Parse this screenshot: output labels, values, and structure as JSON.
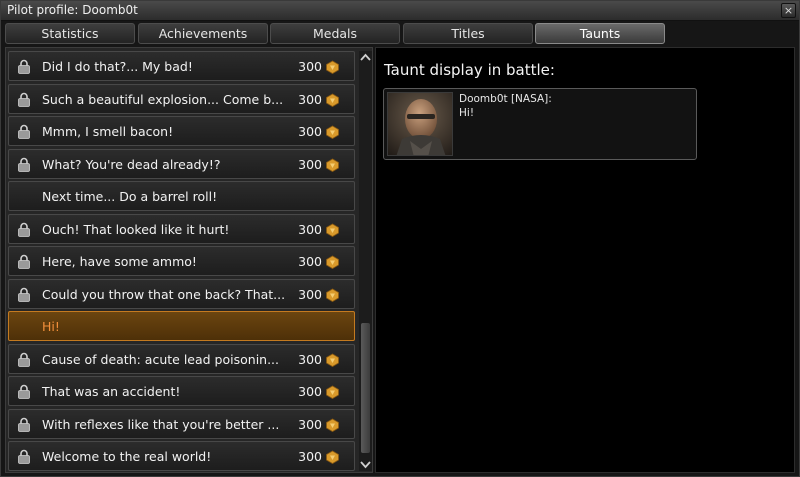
{
  "window": {
    "title": "Pilot profile: Doomb0t",
    "close_label": "×"
  },
  "tabs": [
    {
      "label": "Statistics",
      "active": false
    },
    {
      "label": "Achievements",
      "active": false
    },
    {
      "label": "Medals",
      "active": false
    },
    {
      "label": "Titles",
      "active": false
    },
    {
      "label": "Taunts",
      "active": true
    }
  ],
  "taunts": [
    {
      "text": "Did I do that?... My bad!",
      "price": "300",
      "locked": true,
      "selected": false
    },
    {
      "text": "Such a beautiful explosion... Come b...",
      "price": "300",
      "locked": true,
      "selected": false
    },
    {
      "text": "Mmm, I smell bacon!",
      "price": "300",
      "locked": true,
      "selected": false
    },
    {
      "text": "What? You're dead already!?",
      "price": "300",
      "locked": true,
      "selected": false
    },
    {
      "text": "Next time... Do a barrel roll!",
      "price": "",
      "locked": false,
      "selected": false
    },
    {
      "text": "Ouch! That looked like it hurt!",
      "price": "300",
      "locked": true,
      "selected": false
    },
    {
      "text": "Here, have some ammo!",
      "price": "300",
      "locked": true,
      "selected": false
    },
    {
      "text": "Could you throw that one back? That...",
      "price": "300",
      "locked": true,
      "selected": false
    },
    {
      "text": "Hi!",
      "price": "",
      "locked": false,
      "selected": true
    },
    {
      "text": "Cause of death: acute lead poisonin...",
      "price": "300",
      "locked": true,
      "selected": false
    },
    {
      "text": "That was an accident!",
      "price": "300",
      "locked": true,
      "selected": false
    },
    {
      "text": "With reflexes like that you're better ...",
      "price": "300",
      "locked": true,
      "selected": false
    },
    {
      "text": "Welcome to the real world!",
      "price": "300",
      "locked": true,
      "selected": false
    }
  ],
  "display": {
    "heading": "Taunt display in battle:",
    "pilot_name": "Doomb0t [NASA]:",
    "message": "Hi!"
  },
  "colors": {
    "selected_text": "#f28f3b",
    "selected_border": "#c47a20",
    "coin": "#d99a2b"
  },
  "icons": {
    "lock": "lock-icon",
    "coin": "coin-icon",
    "close": "close-icon"
  }
}
